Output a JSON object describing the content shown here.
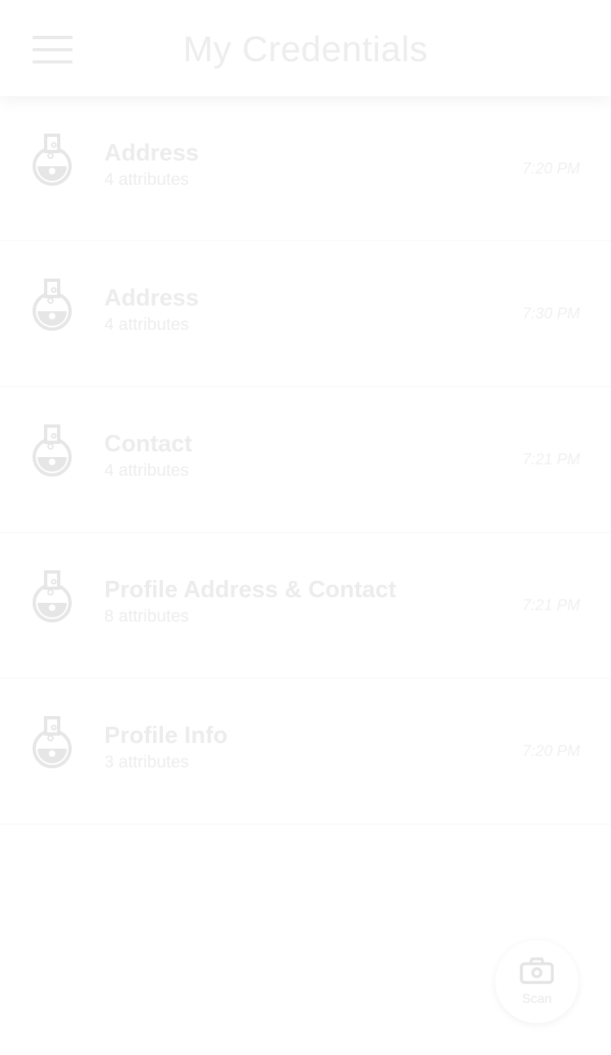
{
  "header": {
    "title": "My Credentials"
  },
  "credentials": [
    {
      "name": "Address",
      "attributes": "4 attributes",
      "time": "7:20 PM",
      "icon": "flask-icon"
    },
    {
      "name": "Address",
      "attributes": "4 attributes",
      "time": "7:30 PM",
      "icon": "flask-icon"
    },
    {
      "name": "Contact",
      "attributes": "4 attributes",
      "time": "7:21 PM",
      "icon": "flask-icon"
    },
    {
      "name": "Profile Address & Contact",
      "attributes": "8 attributes",
      "time": "7:21 PM",
      "icon": "flask-icon"
    },
    {
      "name": "Profile Info",
      "attributes": "3 attributes",
      "time": "7:20 PM",
      "icon": "flask-icon"
    }
  ],
  "fab": {
    "label": "Scan",
    "icon": "camera-icon"
  },
  "colors": {
    "background": "#ffffff",
    "text_faded": "#ececec"
  }
}
